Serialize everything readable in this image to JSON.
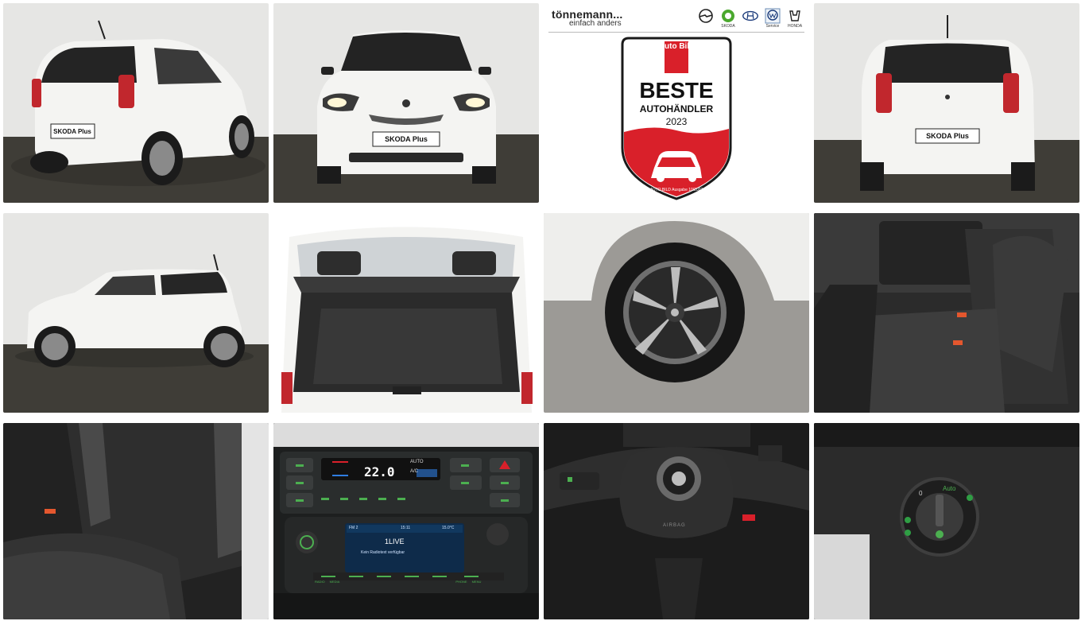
{
  "gallery": {
    "plate_text": "SKODA Plus",
    "ad": {
      "dealer_name": "tönnemann...",
      "dealer_tagline": "einfach anders",
      "brands": [
        "OPEL",
        "SKODA",
        "HYUNDAI",
        "Service",
        "HONDA"
      ],
      "badge_logo": "Auto Bild",
      "badge_title": "BESTE",
      "badge_subtitle": "AUTOHÄNDLER",
      "badge_year": "2023",
      "badge_footer": "AUTO BILD Ausgabe 10/2023"
    },
    "climate": {
      "temperature": "22.0",
      "auto_label": "AUTO",
      "ac_label": "A/C"
    },
    "radio": {
      "station": "1LIVE",
      "message": "Kein Radiotext verfügbar",
      "clock": "15:11",
      "outside_temp": "15.0°C",
      "preset": "FM 2",
      "buttons": [
        "RADIO",
        "MEDIA",
        "PHONE",
        "MENU"
      ]
    },
    "steering": {
      "airbag_label": "AIRBAG"
    },
    "light_switch": {
      "auto_label": "Auto",
      "off_label": "0"
    },
    "colors": {
      "car_white": "#f4f4f2",
      "floor": "#3f3d37",
      "wall": "#e6e6e4",
      "taillight": "#c1272d",
      "interior": "#2a2a2a",
      "badge_red": "#d9202a",
      "panel_green": "#4caf50"
    }
  }
}
